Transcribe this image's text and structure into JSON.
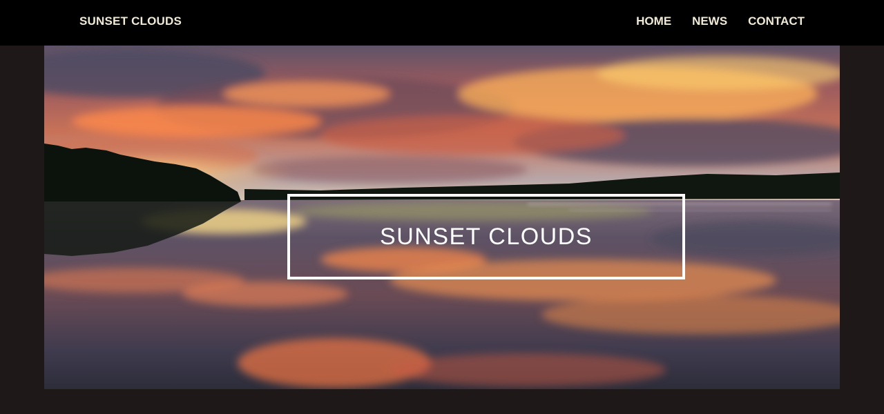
{
  "header": {
    "brand": "SUNSET CLOUDS",
    "nav": [
      {
        "label": "HOME"
      },
      {
        "label": "NEWS"
      },
      {
        "label": "CONTACT"
      }
    ]
  },
  "hero": {
    "title": "SUNSET CLOUDS"
  },
  "colors": {
    "header_bg": "#000000",
    "page_bg": "#1f1818",
    "nav_text": "#f0ead6",
    "title_text": "#ffffff"
  }
}
